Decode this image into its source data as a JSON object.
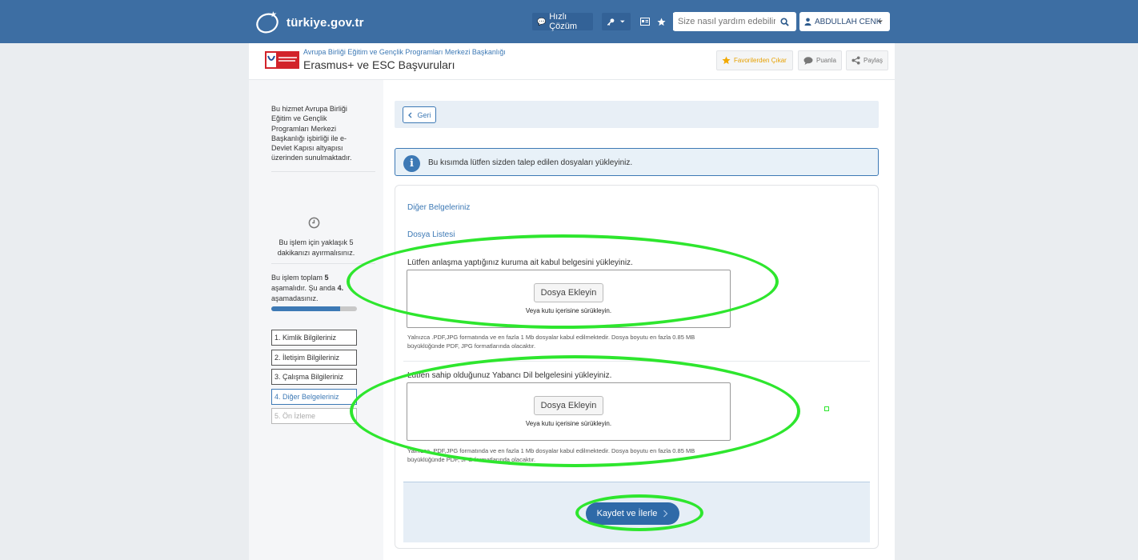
{
  "topbar": {
    "logo_text": "türkiye.gov.tr",
    "quick_solution": "Hızlı Çözüm",
    "search_placeholder": "Size nasıl yardım edebilirim?",
    "user_name": "ABDULLAH CENK",
    "bg_color": "#3d6ea3"
  },
  "service": {
    "institution": "Avrupa Birliği Eğitim ve Gençlik Programları Merkezi Başkanlığı",
    "title": "Erasmus+ ve ESC Başvuruları",
    "favorite_label": "Favorilerden Çıkar",
    "rate_label": "Puanla",
    "share_label": "Paylaş"
  },
  "sidebar": {
    "info": "Bu hizmet Avrupa Birliği Eğitim ve Gençlik Programları Merkezi Başkanlığı işbirliği ile e-Devlet Kapısı altyapısı üzerinden sunulmaktadır.",
    "time_note": "Bu işlem için yaklaşık 5 dakikanızı ayırmalısınız.",
    "steps_note": {
      "prefix": "Bu işlem toplam ",
      "total": "5",
      "mid": " aşamalıdır. Şu anda ",
      "current": "4.",
      "suffix": " aşamadasınız."
    },
    "progress_fraction": 0.8,
    "steps": [
      {
        "label": "1. Kimlik Bilgileriniz",
        "state": "done"
      },
      {
        "label": "2. İletişim Bilgileriniz",
        "state": "done"
      },
      {
        "label": "3. Çalışma Bilgileriniz",
        "state": "done"
      },
      {
        "label": "4. Diğer Belgeleriniz",
        "state": "active"
      },
      {
        "label": "5. Ön İzleme",
        "state": "disabled"
      }
    ]
  },
  "content": {
    "back_label": "Geri",
    "alert_text": "Bu kısımda lütfen sizden talep edilen dosyaları yükleyiniz.",
    "section_title": "Diğer Belgeleriniz",
    "list_title": "Dosya Listesi",
    "uploads": [
      {
        "label": "Lütfen anlaşma yaptığınız kuruma ait kabul belgesini yükleyiniz.",
        "button": "Dosya Ekleyin",
        "hint": "Veya kutu içerisine sürükleyin.",
        "note": "Yalnızca .PDF,JPG formatında ve en fazla 1 Mb dosyalar kabul edilmektedir. Dosya boyutu en fazla 0.85 MB büyüklüğünde PDF, JPG formatlarında olacaktır."
      },
      {
        "label": "Lütfen sahip olduğunuz Yabancı Dil belgelesini yükleyiniz.",
        "button": "Dosya Ekleyin",
        "hint": "Veya kutu içerisine sürükleyin.",
        "note": "Yalnızca .PDF,JPG formatında ve en fazla 1 Mb dosyalar kabul edilmektedir. Dosya boyutu en fazla 0.85 MB büyüklüğünde PDF, JPG formatlarında olacaktır."
      }
    ],
    "save_label": "Kaydet ve İlerle"
  },
  "colors": {
    "accent": "#3d79b5",
    "annotation": "#2ee62e"
  }
}
